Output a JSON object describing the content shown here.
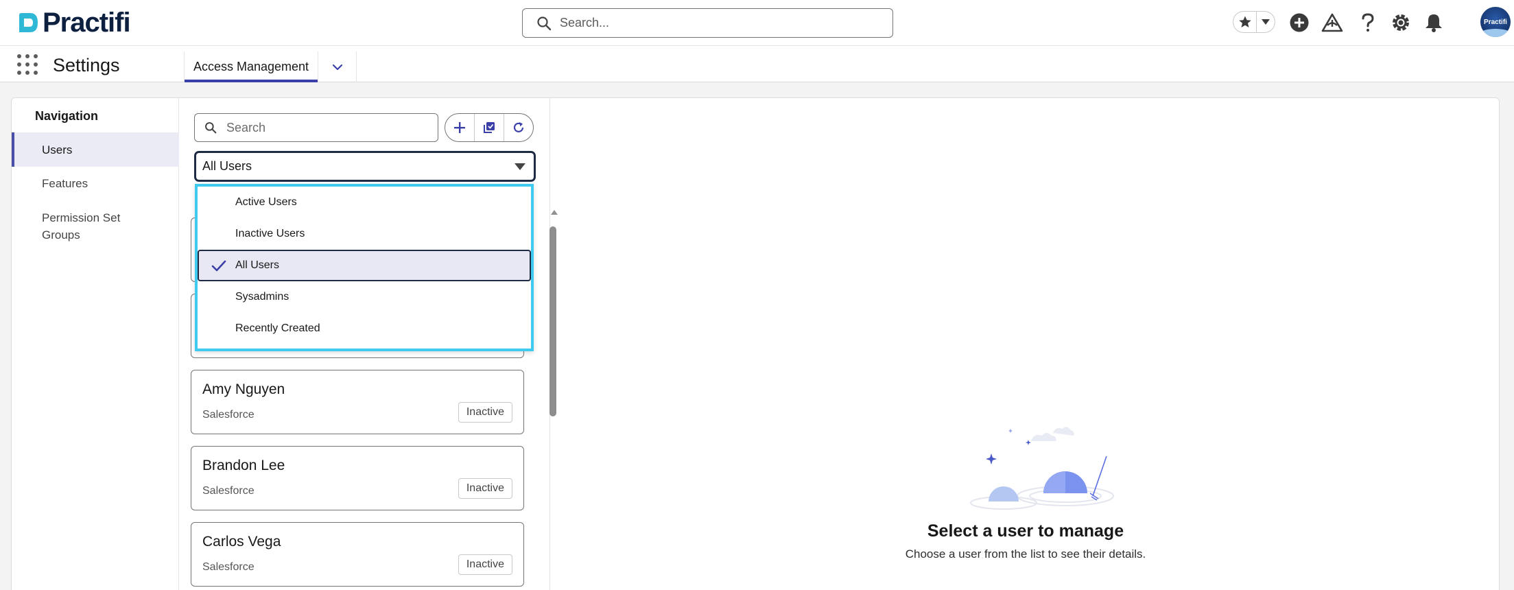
{
  "header": {
    "brand": "Practifi",
    "search_placeholder": "Search...",
    "avatar_text": "Practifi"
  },
  "app_nav": {
    "app_name": "Settings",
    "active_tab": "Access Management"
  },
  "left_nav": {
    "heading": "Navigation",
    "items": [
      {
        "label": "Users",
        "active": true
      },
      {
        "label": "Features",
        "active": false
      },
      {
        "label": "Permission Set Groups",
        "active": false
      }
    ]
  },
  "list": {
    "search_placeholder": "Search",
    "filter_selected": "All Users",
    "users": [
      {
        "name": "Amy Nguyen",
        "source": "Salesforce",
        "status": "Inactive"
      },
      {
        "name": "Brandon Lee",
        "source": "Salesforce",
        "status": "Inactive"
      },
      {
        "name": "Carlos Vega",
        "source": "Salesforce",
        "status": "Inactive"
      }
    ]
  },
  "dropdown": {
    "options": [
      {
        "label": "Active Users",
        "selected": false
      },
      {
        "label": "Inactive Users",
        "selected": false
      },
      {
        "label": "All Users",
        "selected": true
      },
      {
        "label": "Sysadmins",
        "selected": false
      },
      {
        "label": "Recently Created",
        "selected": false
      }
    ]
  },
  "empty_state": {
    "title": "Select a user to manage",
    "subtitle": "Choose a user from the list to see their details."
  },
  "colors": {
    "brand": "#0d2040",
    "accent": "#3b3fa8",
    "focus_ring": "#3ecbef"
  }
}
